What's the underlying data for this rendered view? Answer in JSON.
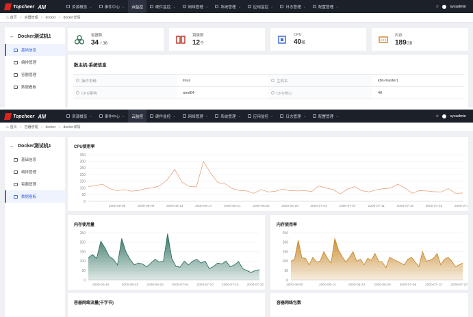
{
  "app": {
    "logo_text": "Topcheer",
    "logo_ai": "AM"
  },
  "nav": [
    {
      "label": "资源概览",
      "active": false
    },
    {
      "label": "事件中心",
      "active": false
    },
    {
      "label": "云监控",
      "active": true
    },
    {
      "label": "硬件监控",
      "active": false
    },
    {
      "label": "网络管理",
      "active": false
    },
    {
      "label": "系统管理",
      "active": false
    },
    {
      "label": "应用监控",
      "active": false
    },
    {
      "label": "日志管理",
      "active": false
    },
    {
      "label": "配置管理",
      "active": false
    }
  ],
  "user": {
    "name": "sysadmin"
  },
  "breadcrumb": [
    "首页",
    "容器管理",
    "docker",
    "docker详情"
  ],
  "sidebar": {
    "title": "Docker测试机1",
    "items": [
      {
        "label": "基础信息"
      },
      {
        "label": "编排管理"
      },
      {
        "label": "容器管理"
      },
      {
        "label": "数据看板"
      }
    ]
  },
  "stats": [
    {
      "label": "容器数",
      "value": "34",
      "suffix": "/ 36",
      "color": "#3a7a5b"
    },
    {
      "label": "镜像数",
      "value": "12",
      "suffix": "个",
      "color": "#c0392b"
    },
    {
      "label": "CPU",
      "value": "40",
      "suffix": "核",
      "color": "#3f6bd8"
    },
    {
      "label": "内存",
      "value": "189",
      "suffix": "GB",
      "color": "#d98b2b"
    }
  ],
  "info": {
    "title": "数主机-系统信息",
    "rows": [
      {
        "k1": "操作系统",
        "v1": "linux",
        "k2": "主机名",
        "v2": "k8s-master1"
      },
      {
        "k1": "CPU架构",
        "v1": "amd64",
        "k2": "CPU核心",
        "v2": "40"
      }
    ]
  },
  "panels": {
    "cpu_title": "CPU使用率",
    "mem_title": "内存使用量",
    "memrate_title": "内存使用率",
    "net_title": "容器网络流量(千字节)",
    "netpkt_title": "容器网络包数"
  },
  "colors": {
    "cpu": "#e8a07a",
    "mem": "#2f6f5f",
    "memrate": "#c98a2e",
    "accent": "#3f6bd8"
  },
  "chart_data": [
    {
      "type": "line",
      "title": "CPU使用率",
      "x": [
        "2000-06-01",
        "2000-06-02",
        "2000-06-03",
        "2000-06-04",
        "2000-06-05",
        "2000-06-06",
        "2000-06-07",
        "2000-06-08",
        "2000-06-09",
        "2000-06-10",
        "2000-06-11",
        "2000-06-12",
        "2000-06-13",
        "2000-06-14",
        "2000-06-15",
        "2000-06-16",
        "2000-06-17",
        "2000-06-18",
        "2000-06-19",
        "2000-06-20",
        "2000-06-21",
        "2000-06-22",
        "2000-06-23",
        "2000-06-24",
        "2000-06-25",
        "2000-06-26",
        "2000-06-27",
        "2000-06-28",
        "2000-06-29",
        "2000-06-30",
        "2000-07-01",
        "2000-07-02",
        "2000-07-03",
        "2000-07-04",
        "2000-07-05",
        "2000-07-06",
        "2000-07-07",
        "2000-07-08",
        "2000-07-09",
        "2000-07-10",
        "2000-07-11",
        "2000-07-12",
        "2000-07-13",
        "2000-07-14",
        "2000-07-15",
        "2000-07-16",
        "2000-07-17",
        "2000-07-18",
        "2000-07-19",
        "2000-07-20",
        "2000-07-21",
        "2000-07-22",
        "2000-07-23"
      ],
      "values": [
        110,
        118,
        128,
        95,
        80,
        88,
        76,
        82,
        95,
        102,
        118,
        165,
        240,
        145,
        112,
        108,
        300,
        210,
        140,
        132,
        95,
        82,
        78,
        60,
        88,
        70,
        76,
        92,
        80,
        78,
        82,
        72,
        115,
        100,
        88,
        55,
        92,
        110,
        80,
        70,
        86,
        95,
        100,
        128,
        98,
        60,
        80,
        78,
        72,
        70,
        95,
        60,
        62
      ],
      "xticks": [
        "2000-06-05",
        "2000-06-09",
        "2000-06-13",
        "2000-06-17",
        "2000-06-21",
        "2000-06-25",
        "2000-06-29",
        "2000-07-03",
        "2000-07-07",
        "2000-07-11",
        "2000-07-15",
        "2000-07-19",
        "2000-07-23"
      ],
      "ylim": [
        0,
        350
      ],
      "yticks": [
        0,
        50,
        100,
        150,
        200,
        250,
        300,
        350
      ]
    },
    {
      "type": "area",
      "title": "内存使用量",
      "x": [
        "2000-06-12",
        "2000-06-13",
        "2000-06-14",
        "2000-06-15",
        "2000-06-16",
        "2000-06-17",
        "2000-06-18",
        "2000-06-19",
        "2000-06-20",
        "2000-06-21",
        "2000-06-22",
        "2000-06-23",
        "2000-06-24",
        "2000-06-25",
        "2000-06-26",
        "2000-06-27",
        "2000-06-28",
        "2000-06-29",
        "2000-06-30",
        "2000-07-01",
        "2000-07-02",
        "2000-07-03",
        "2000-07-04",
        "2000-07-05",
        "2000-07-06",
        "2000-07-07",
        "2000-07-08",
        "2000-07-09",
        "2000-07-10",
        "2000-07-11",
        "2000-07-12",
        "2000-07-13",
        "2000-07-14",
        "2000-07-15",
        "2000-07-16",
        "2000-07-17",
        "2000-07-18",
        "2000-07-19",
        "2000-07-20",
        "2000-07-21",
        "2000-07-22",
        "2000-07-23"
      ],
      "values": [
        118,
        135,
        115,
        205,
        170,
        125,
        110,
        80,
        220,
        150,
        110,
        80,
        90,
        85,
        70,
        90,
        110,
        95,
        100,
        245,
        115,
        72,
        68,
        100,
        80,
        100,
        110,
        90,
        100,
        60,
        72,
        90,
        85,
        100,
        70,
        80,
        98,
        60,
        50,
        40,
        50,
        55
      ],
      "xticks": [
        "2000-06-15",
        "2000-06-22",
        "2000-06-28",
        "2000-07-04",
        "2000-07-10",
        "2000-07-16",
        "2000-07-22"
      ],
      "ylim": [
        0,
        250
      ],
      "yticks": [
        0,
        50,
        100,
        150,
        200,
        250
      ]
    },
    {
      "type": "area",
      "title": "内存使用率",
      "x": [
        "2000-06-04",
        "2000-06-05",
        "2000-06-06",
        "2000-06-07",
        "2000-06-08",
        "2000-06-09",
        "2000-06-10",
        "2000-06-11",
        "2000-06-12",
        "2000-06-13",
        "2000-06-14",
        "2000-06-15",
        "2000-06-16",
        "2000-06-17",
        "2000-06-18",
        "2000-06-19",
        "2000-06-20",
        "2000-06-21",
        "2000-06-22",
        "2000-06-23",
        "2000-06-24",
        "2000-06-25",
        "2000-06-26",
        "2000-06-27",
        "2000-06-28",
        "2000-06-29",
        "2000-06-30",
        "2000-07-01",
        "2000-07-02",
        "2000-07-03",
        "2000-07-04",
        "2000-07-05",
        "2000-07-06",
        "2000-07-07",
        "2000-07-08",
        "2000-07-09",
        "2000-07-10",
        "2000-07-11",
        "2000-07-12",
        "2000-07-13",
        "2000-07-14",
        "2000-07-15",
        "2000-07-16",
        "2000-07-17",
        "2000-07-18",
        "2000-07-19",
        "2000-07-20",
        "2000-07-21"
      ],
      "values": [
        100,
        110,
        210,
        118,
        115,
        80,
        120,
        95,
        100,
        150,
        115,
        90,
        220,
        160,
        125,
        95,
        120,
        150,
        100,
        110,
        80,
        115,
        105,
        140,
        100,
        95,
        65,
        120,
        110,
        100,
        90,
        80,
        110,
        120,
        95,
        70,
        150,
        100,
        105,
        115,
        140,
        80,
        110,
        120,
        100,
        70,
        80,
        90
      ],
      "xticks": [
        "2000-06-05",
        "2000-06-14",
        "2000-06-22",
        "2000-06-29",
        "2000-07-06",
        "2000-07-13",
        "2000-07-20"
      ],
      "ylim": [
        0,
        250
      ],
      "yticks": [
        0,
        50,
        100,
        150,
        200,
        250
      ]
    }
  ]
}
